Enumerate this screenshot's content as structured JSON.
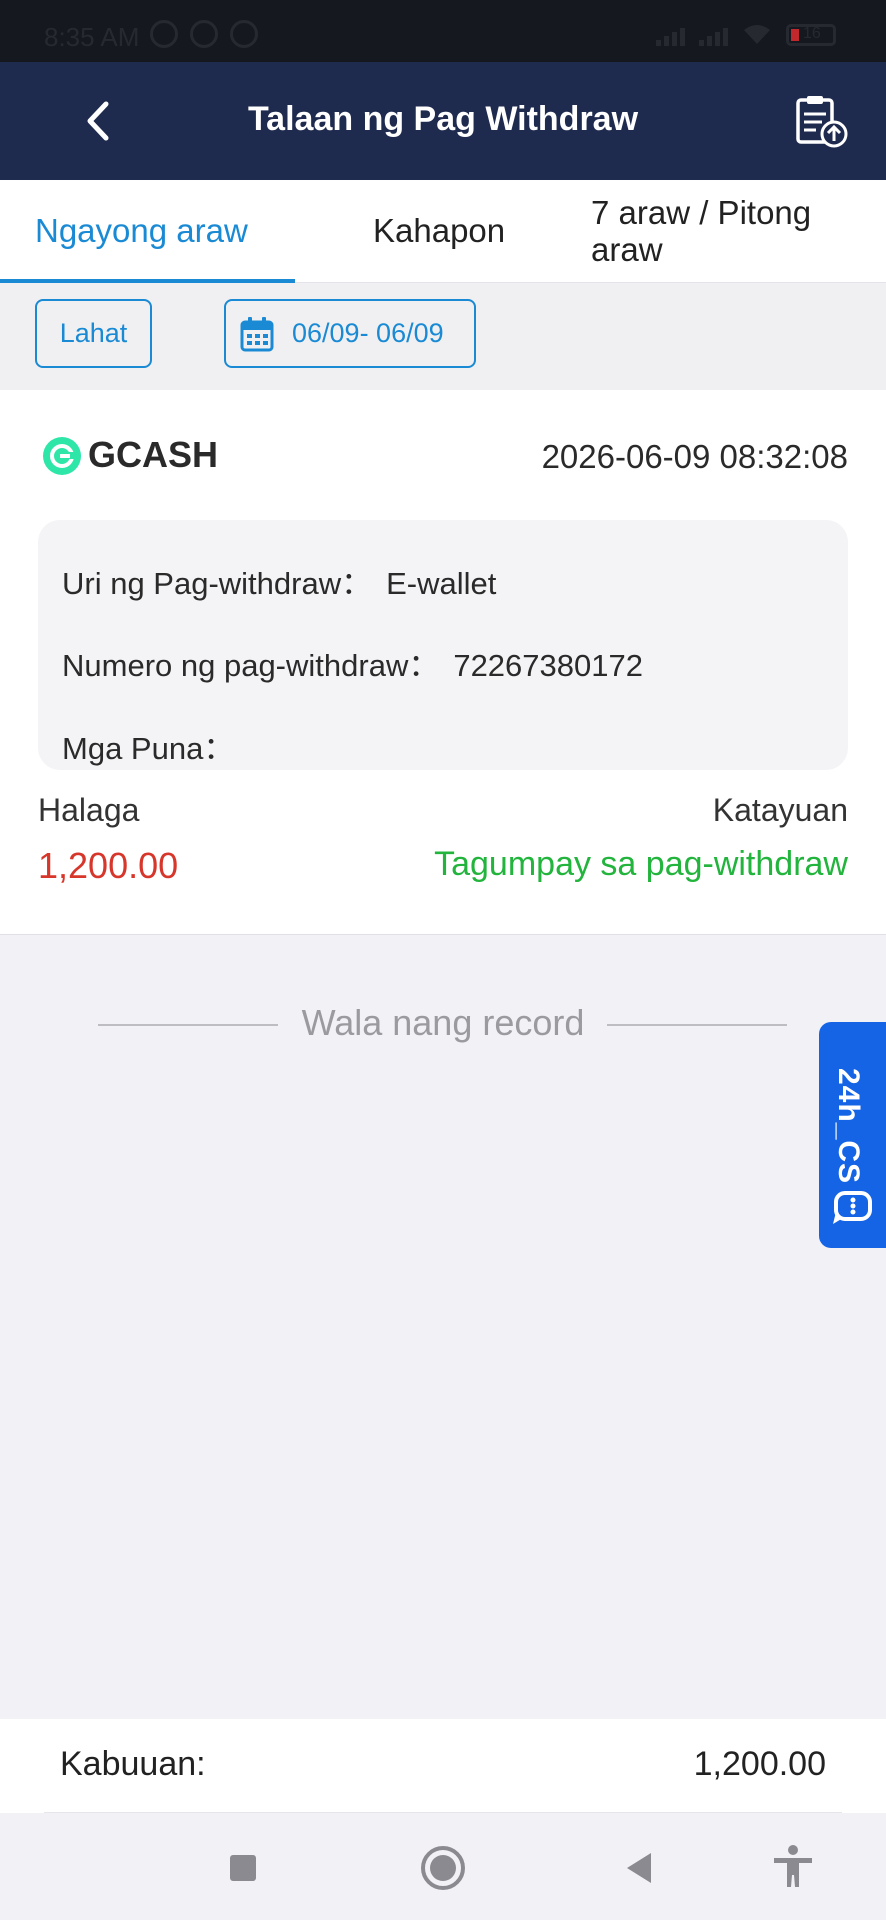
{
  "status_bar": {
    "time": "8:35 AM",
    "battery": "16"
  },
  "header": {
    "title": "Talaan ng Pag Withdraw"
  },
  "tabs": [
    {
      "label": "Ngayong araw"
    },
    {
      "label": "Kahapon"
    },
    {
      "label": "7 araw / Pitong araw"
    }
  ],
  "filters": {
    "all_label": "Lahat",
    "date_range": "06/09- 06/09"
  },
  "record": {
    "method": "GCASH",
    "timestamp": "2026-06-09 08:32:08",
    "type_label": "Uri ng Pag-withdraw：",
    "type_value": "E-wallet",
    "number_label": "Numero ng pag-withdraw：",
    "number_value": "72267380172",
    "remarks_label": "Mga Puna：",
    "remarks_value": "",
    "amount_label": "Halaga",
    "amount_value": "1,200.00",
    "status_label": "Katayuan",
    "status_value": "Tagumpay sa pag-withdraw"
  },
  "no_more_text": "Wala nang record",
  "cs_button": {
    "label": "24h_CS"
  },
  "footer": {
    "total_label": "Kabuuan:",
    "total_value": "1,200.00"
  },
  "colors": {
    "header_bg": "#1f2b4e",
    "accent_blue": "#1a8ad4",
    "amount_red": "#d7362b",
    "success_green": "#22b43c",
    "cs_blue": "#1664e6"
  }
}
